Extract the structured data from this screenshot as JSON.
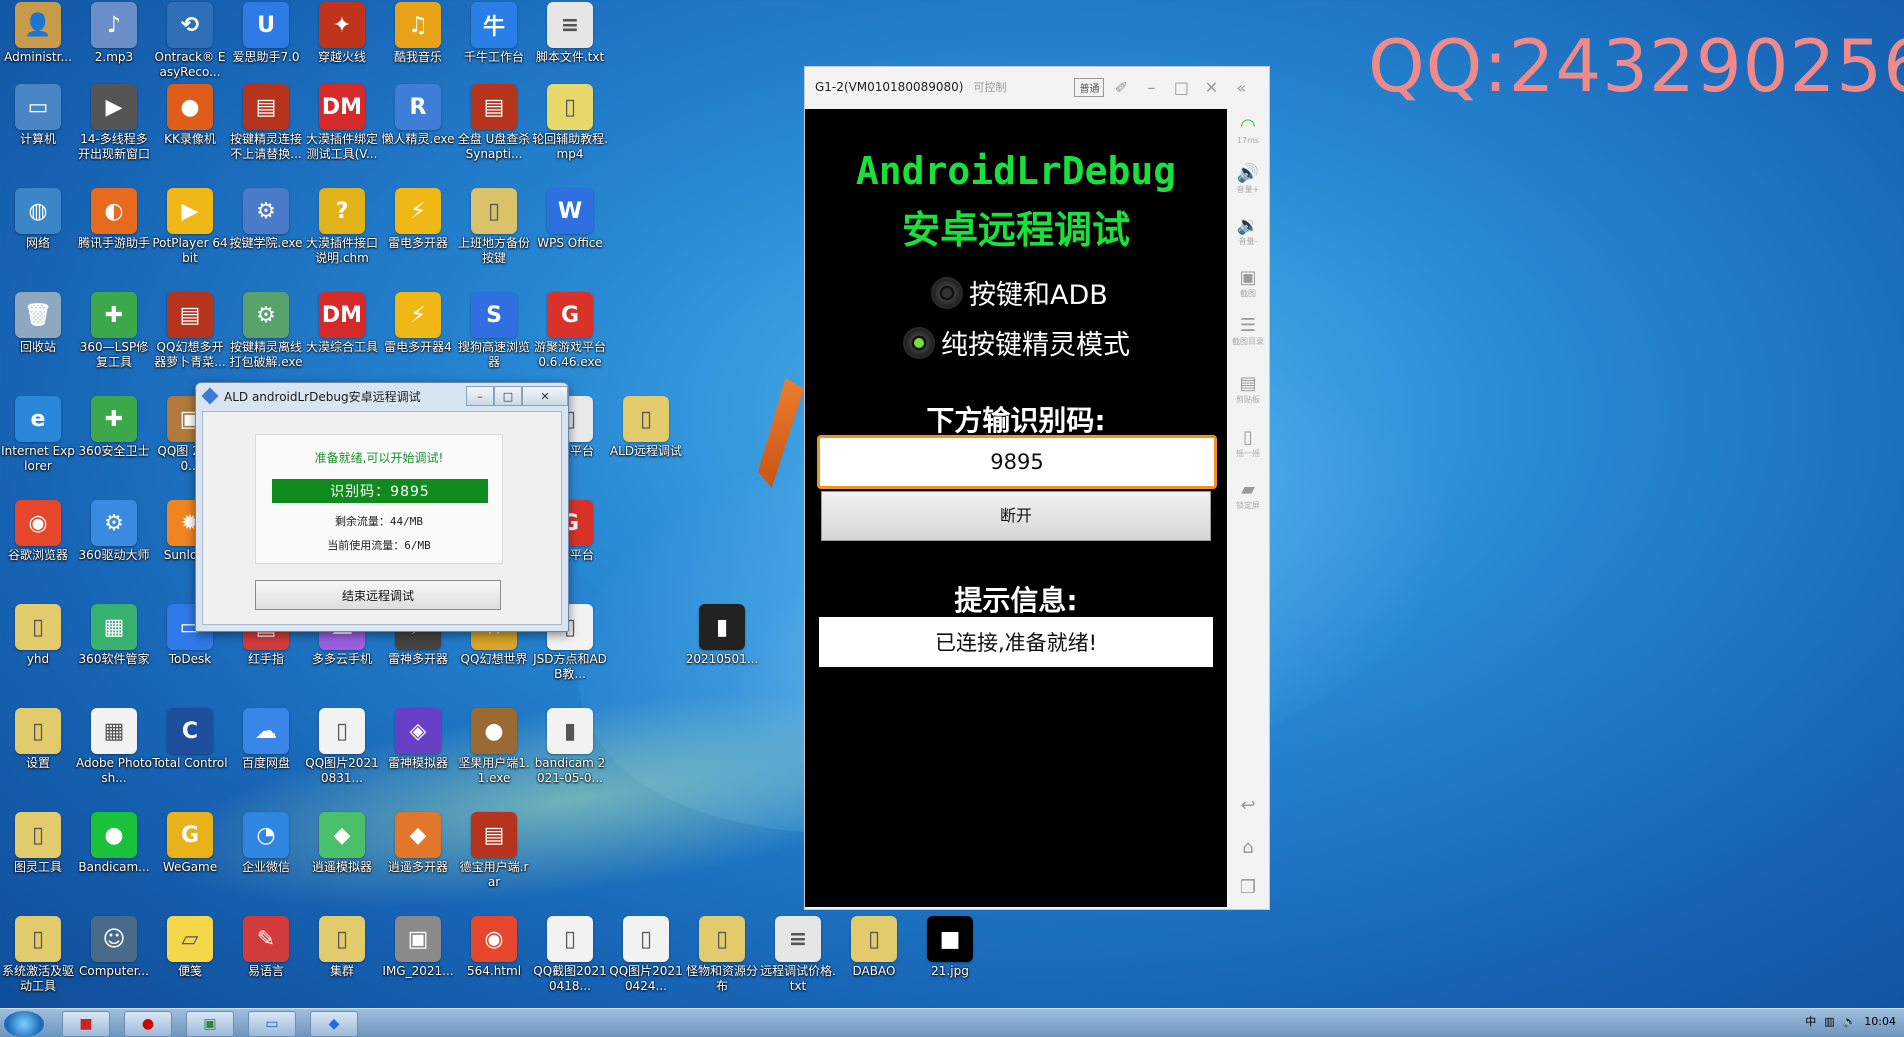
{
  "watermark": "QQ:2432902565",
  "desktop_icons": [
    {
      "label": "Administr...",
      "glyph": "👤",
      "color": "#c79b4a"
    },
    {
      "label": "2.mp3",
      "glyph": "♪",
      "color": "#6a8fc8"
    },
    {
      "label": "Ontrack® EasyReco...",
      "glyph": "⟲",
      "color": "#2f6fb8"
    },
    {
      "label": "爱思助手7.0",
      "glyph": "U",
      "color": "#2e7be6"
    },
    {
      "label": "穿越火线",
      "glyph": "✦",
      "color": "#c0341c"
    },
    {
      "label": "酷我音乐",
      "glyph": "♫",
      "color": "#e8a21a"
    },
    {
      "label": "千牛工作台",
      "glyph": "牛",
      "color": "#2a7ee8"
    },
    {
      "label": "脚本文件.txt",
      "glyph": "≡",
      "color": "#e6e6e6"
    },
    {
      "label": "计算机",
      "glyph": "▭",
      "color": "#4a86c5"
    },
    {
      "label": "14-多线程多开出现新窗口",
      "glyph": "▶",
      "color": "#555555"
    },
    {
      "label": "KK录像机",
      "glyph": "●",
      "color": "#e05c1a"
    },
    {
      "label": "按键精灵连接不上请替换...",
      "glyph": "▤",
      "color": "#b6331e"
    },
    {
      "label": "大漠插件绑定测试工具(V...",
      "glyph": "DM",
      "color": "#d62a2a"
    },
    {
      "label": "懒人精灵.exe",
      "glyph": "R",
      "color": "#3f7ed8"
    },
    {
      "label": "全盘 U盘查杀Synapti...",
      "glyph": "▤",
      "color": "#b6331e"
    },
    {
      "label": "轮回辅助教程.mp4",
      "glyph": "▯",
      "color": "#e7d86a"
    },
    {
      "label": "网络",
      "glyph": "◍",
      "color": "#3a86c8"
    },
    {
      "label": "腾讯手游助手",
      "glyph": "◐",
      "color": "#e76a1e"
    },
    {
      "label": "PotPlayer 64 bit",
      "glyph": "▶",
      "color": "#f0b816"
    },
    {
      "label": "按键学院.exe",
      "glyph": "⚙",
      "color": "#4a7bc8"
    },
    {
      "label": "大漠插件接口说明.chm",
      "glyph": "?",
      "color": "#e2b21a"
    },
    {
      "label": "雷电多开器",
      "glyph": "⚡",
      "color": "#f0b816"
    },
    {
      "label": "上班地方备份按键",
      "glyph": "▯",
      "color": "#d9c26a"
    },
    {
      "label": "WPS Office",
      "glyph": "W",
      "color": "#2f6fe0"
    },
    {
      "label": "回收站",
      "glyph": "🗑",
      "color": "#8fa8c2"
    },
    {
      "label": "360—LSP修复工具",
      "glyph": "✚",
      "color": "#3ca84a"
    },
    {
      "label": "QQ幻想多开器萝卜青菜...",
      "glyph": "▤",
      "color": "#b6331e"
    },
    {
      "label": "按键精灵离线打包破解.exe",
      "glyph": "⚙",
      "color": "#57a36b"
    },
    {
      "label": "大漠综合工具",
      "glyph": "DM",
      "color": "#d62a2a"
    },
    {
      "label": "雷电多开器4",
      "glyph": "⚡",
      "color": "#f0b816"
    },
    {
      "label": "搜狗高速浏览器",
      "glyph": "S",
      "color": "#2f6fe0"
    },
    {
      "label": "游聚游戏平台 0.6.46.exe",
      "glyph": "G",
      "color": "#d9322a"
    },
    {
      "label": "Internet Explorer",
      "glyph": "e",
      "color": "#2a86d8"
    },
    {
      "label": "360安全卫士",
      "glyph": "✚",
      "color": "#3ca84a"
    },
    {
      "label": "QQ图 20210...",
      "glyph": "▣",
      "color": "#b07a3a"
    },
    {
      "label": "游戏平台",
      "glyph": "▯",
      "color": "#e8e8e8"
    },
    {
      "label": "ALD远程调试",
      "glyph": "▯",
      "color": "#e1cb6c"
    },
    {
      "label": "谷歌浏览器",
      "glyph": "◉",
      "color": "#e6462b"
    },
    {
      "label": "360驱动大师",
      "glyph": "⚙",
      "color": "#3a8ae0"
    },
    {
      "label": "Sunlog...",
      "glyph": "✹",
      "color": "#f08420"
    },
    {
      "label": "游戏平台",
      "glyph": "G",
      "color": "#d9322a"
    },
    {
      "label": "yhd",
      "glyph": "▯",
      "color": "#e1cb6c"
    },
    {
      "label": "360软件管家",
      "glyph": "▦",
      "color": "#38b070"
    },
    {
      "label": "ToDesk",
      "glyph": "▭",
      "color": "#2f7ae8"
    },
    {
      "label": "红手指",
      "glyph": "▤",
      "color": "#d23b3b"
    },
    {
      "label": "多多云手机",
      "glyph": "☁",
      "color": "#9c5ee0"
    },
    {
      "label": "雷神多开器",
      "glyph": "⚡",
      "color": "#444444"
    },
    {
      "label": "QQ幻想世界",
      "glyph": "★",
      "color": "#d9a52a"
    },
    {
      "label": "JSD方点和ADB教...",
      "glyph": "▯",
      "color": "#f2f2f2"
    },
    {
      "label": "20210501...",
      "glyph": "▮",
      "color": "#222222"
    },
    {
      "label": "设置",
      "glyph": "▯",
      "color": "#e1cb6c"
    },
    {
      "label": "Adobe Photosh...",
      "glyph": "▦",
      "color": "#f2f2f2"
    },
    {
      "label": "Total Control",
      "glyph": "C",
      "color": "#1d4f9c"
    },
    {
      "label": "百度网盘",
      "glyph": "☁",
      "color": "#3a86e8"
    },
    {
      "label": "QQ图片20210831...",
      "glyph": "▯",
      "color": "#f2f2f2"
    },
    {
      "label": "雷神模拟器",
      "glyph": "◈",
      "color": "#6a3fc8"
    },
    {
      "label": "坚果用户端1.1.exe",
      "glyph": "●",
      "color": "#9b6a32"
    },
    {
      "label": "bandicam 2021-05-0...",
      "glyph": "▮",
      "color": "#f2f2f2"
    },
    {
      "label": "图灵工具",
      "glyph": "▯",
      "color": "#e1cb6c"
    },
    {
      "label": "Bandicam...",
      "glyph": "●",
      "color": "#19c23a"
    },
    {
      "label": "WeGame",
      "glyph": "G",
      "color": "#e8b21a"
    },
    {
      "label": "企业微信",
      "glyph": "◔",
      "color": "#2f86e0"
    },
    {
      "label": "逍遥模拟器",
      "glyph": "◆",
      "color": "#4ac06a"
    },
    {
      "label": "逍遥多开器",
      "glyph": "◆",
      "color": "#e2762a"
    },
    {
      "label": "德宝用户端.rar",
      "glyph": "▤",
      "color": "#b6331e"
    },
    {
      "label": "系统激活及驱动工具",
      "glyph": "▯",
      "color": "#e1cb6c"
    },
    {
      "label": "Computer...",
      "glyph": "☺",
      "color": "#4a6a8a"
    },
    {
      "label": "便笺",
      "glyph": "▱",
      "color": "#f5d84a"
    },
    {
      "label": "易语言",
      "glyph": "✎",
      "color": "#d23b3b"
    },
    {
      "label": "集群",
      "glyph": "▯",
      "color": "#e1cb6c"
    },
    {
      "label": "IMG_2021...",
      "glyph": "▣",
      "color": "#8a8a8a"
    },
    {
      "label": "564.html",
      "glyph": "◉",
      "color": "#e6462b"
    },
    {
      "label": "QQ截图20210418...",
      "glyph": "▯",
      "color": "#f2f2f2"
    },
    {
      "label": "QQ图片20210424...",
      "glyph": "▯",
      "color": "#f2f2f2"
    },
    {
      "label": "怪物和资源分布",
      "glyph": "▯",
      "color": "#e1cb6c"
    },
    {
      "label": "远程调试价格.txt",
      "glyph": "≡",
      "color": "#e6e6e6"
    },
    {
      "label": "DABAO",
      "glyph": "▯",
      "color": "#e1cb6c"
    },
    {
      "label": "21.jpg",
      "glyph": "■",
      "color": "#000000"
    }
  ],
  "ald_dialog": {
    "title": "ALD androidLrDebug安卓远程调试",
    "ready": "准备就绪,可以开始调试!",
    "code": "识别码：9895",
    "remaining": "剩余流量：44/MB",
    "used": "当前使用流量：6/MB",
    "end_button": "结束远程调试"
  },
  "phone_window": {
    "title": "G1-2(VM010180089080)",
    "signal": "可控制",
    "badge": "普通",
    "app_title": "AndroidLrDebug",
    "app_subtitle": "安卓远程调试",
    "radio_adb": "按键和ADB",
    "radio_pure": "纯按键精灵模式",
    "input_label": "下方输识别码:",
    "code_value": "9895",
    "disconnect": "断开",
    "tip_label": "提示信息:",
    "tip_value": "已连接,准备就绪!",
    "side": {
      "latency": "17ms",
      "vol_up": "音量+",
      "vol_down": "音量-",
      "screenshot": "截图",
      "screenshot_dir": "截图目录",
      "clipboard": "剪贴板",
      "shake": "摇一摇",
      "lock": "锁定屏"
    }
  },
  "taskbar": {
    "clock": "10:04",
    "ime": "中"
  }
}
